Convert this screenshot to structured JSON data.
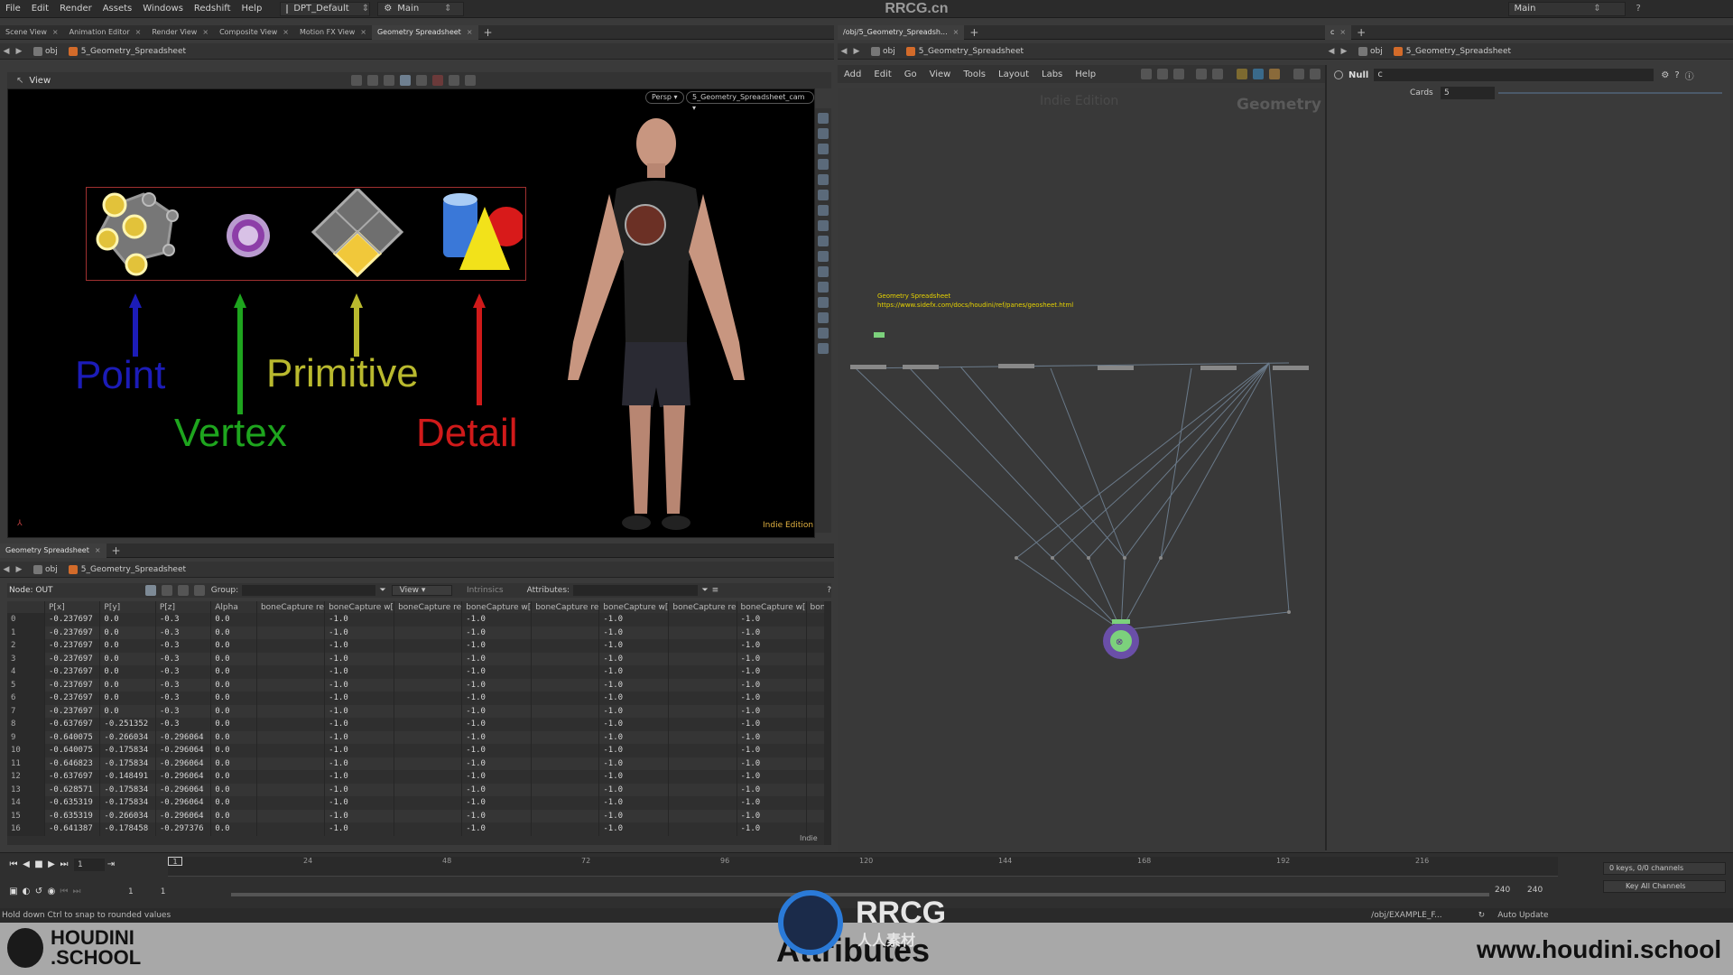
{
  "menubar": {
    "items": [
      "File",
      "Edit",
      "Render",
      "Assets",
      "Windows",
      "Redshift",
      "Help"
    ],
    "desktop": "DPT_Default",
    "context": "Main",
    "right_context": "Main"
  },
  "left_tabs": [
    "Scene View",
    "Animation Editor",
    "Render View",
    "Composite View",
    "Motion FX View",
    "Geometry Spreadsheet"
  ],
  "left_path": {
    "root": "obj",
    "node": "5_Geometry_Spreadsheet"
  },
  "viewport": {
    "label": "View",
    "persp": "Persp",
    "camera": "5_Geometry_Spreadsheet_cam",
    "edition": "Indie Edition",
    "labels": {
      "point": "Point",
      "vertex": "Vertex",
      "primitive": "Primitive",
      "detail": "Detail"
    },
    "colors": {
      "point": "#1c1cb8",
      "vertex": "#1ea51e",
      "primitive": "#b9b92e",
      "detail": "#d01a1a"
    }
  },
  "spreadsheet": {
    "tab": "Geometry Spreadsheet",
    "path_root": "obj",
    "path_node": "5_Geometry_Spreadsheet",
    "node_label": "Node: OUT",
    "group_label": "Group:",
    "view_label": "View",
    "intrinsics_label": "Intrinsics",
    "attributes_label": "Attributes:",
    "columns": [
      "",
      "P[x]",
      "P[y]",
      "P[z]",
      "Alpha",
      "boneCapture re",
      "boneCapture w[",
      "boneCapture re",
      "boneCapture w[",
      "boneCapture re",
      "boneCapture w[",
      "boneCapture re",
      "boneCapture w[",
      "bone"
    ],
    "rows": [
      [
        "0",
        "-0.237697",
        "0.0",
        "-0.3",
        "0.0",
        "",
        "-1.0",
        "",
        "-1.0",
        "",
        "-1.0",
        "",
        "-1.0",
        ""
      ],
      [
        "1",
        "-0.237697",
        "0.0",
        "-0.3",
        "0.0",
        "",
        "-1.0",
        "",
        "-1.0",
        "",
        "-1.0",
        "",
        "-1.0",
        ""
      ],
      [
        "2",
        "-0.237697",
        "0.0",
        "-0.3",
        "0.0",
        "",
        "-1.0",
        "",
        "-1.0",
        "",
        "-1.0",
        "",
        "-1.0",
        ""
      ],
      [
        "3",
        "-0.237697",
        "0.0",
        "-0.3",
        "0.0",
        "",
        "-1.0",
        "",
        "-1.0",
        "",
        "-1.0",
        "",
        "-1.0",
        ""
      ],
      [
        "4",
        "-0.237697",
        "0.0",
        "-0.3",
        "0.0",
        "",
        "-1.0",
        "",
        "-1.0",
        "",
        "-1.0",
        "",
        "-1.0",
        ""
      ],
      [
        "5",
        "-0.237697",
        "0.0",
        "-0.3",
        "0.0",
        "",
        "-1.0",
        "",
        "-1.0",
        "",
        "-1.0",
        "",
        "-1.0",
        ""
      ],
      [
        "6",
        "-0.237697",
        "0.0",
        "-0.3",
        "0.0",
        "",
        "-1.0",
        "",
        "-1.0",
        "",
        "-1.0",
        "",
        "-1.0",
        ""
      ],
      [
        "7",
        "-0.237697",
        "0.0",
        "-0.3",
        "0.0",
        "",
        "-1.0",
        "",
        "-1.0",
        "",
        "-1.0",
        "",
        "-1.0",
        ""
      ],
      [
        "8",
        "-0.637697",
        "-0.251352",
        "-0.3",
        "0.0",
        "",
        "-1.0",
        "",
        "-1.0",
        "",
        "-1.0",
        "",
        "-1.0",
        ""
      ],
      [
        "9",
        "-0.640075",
        "-0.266034",
        "-0.296064",
        "0.0",
        "",
        "-1.0",
        "",
        "-1.0",
        "",
        "-1.0",
        "",
        "-1.0",
        ""
      ],
      [
        "10",
        "-0.640075",
        "-0.175834",
        "-0.296064",
        "0.0",
        "",
        "-1.0",
        "",
        "-1.0",
        "",
        "-1.0",
        "",
        "-1.0",
        ""
      ],
      [
        "11",
        "-0.646823",
        "-0.175834",
        "-0.296064",
        "0.0",
        "",
        "-1.0",
        "",
        "-1.0",
        "",
        "-1.0",
        "",
        "-1.0",
        ""
      ],
      [
        "12",
        "-0.637697",
        "-0.148491",
        "-0.296064",
        "0.0",
        "",
        "-1.0",
        "",
        "-1.0",
        "",
        "-1.0",
        "",
        "-1.0",
        ""
      ],
      [
        "13",
        "-0.628571",
        "-0.175834",
        "-0.296064",
        "0.0",
        "",
        "-1.0",
        "",
        "-1.0",
        "",
        "-1.0",
        "",
        "-1.0",
        ""
      ],
      [
        "14",
        "-0.635319",
        "-0.175834",
        "-0.296064",
        "0.0",
        "",
        "-1.0",
        "",
        "-1.0",
        "",
        "-1.0",
        "",
        "-1.0",
        ""
      ],
      [
        "15",
        "-0.635319",
        "-0.266034",
        "-0.296064",
        "0.0",
        "",
        "-1.0",
        "",
        "-1.0",
        "",
        "-1.0",
        "",
        "-1.0",
        ""
      ],
      [
        "16",
        "-0.641387",
        "-0.178458",
        "-0.297376",
        "0.0",
        "",
        "-1.0",
        "",
        "-1.0",
        "",
        "-1.0",
        "",
        "-1.0",
        ""
      ]
    ],
    "indie": "Indie"
  },
  "network": {
    "tab": "/obj/5_Geometry_Spreadsh...",
    "path_root": "obj",
    "path_node": "5_Geometry_Spreadsheet",
    "menu": [
      "Add",
      "Edit",
      "Go",
      "View",
      "Tools",
      "Layout",
      "Labs",
      "Help"
    ],
    "watermark_edition": "Indie Edition",
    "context_label": "Geometry",
    "sticky_title": "Geometry Spreadsheet",
    "sticky_url": "https://www.sidefx.com/docs/houdini/ref/panes/geosheet.html"
  },
  "params": {
    "tab": "c",
    "path_root": "obj",
    "path_node": "5_Geometry_Spreadsheet",
    "node_type": "Null",
    "node_name": "c",
    "cards_label": "Cards",
    "cards_value": "5"
  },
  "timeline": {
    "ticks": [
      "24",
      "48",
      "72",
      "96",
      "120",
      "144",
      "168",
      "192",
      "216"
    ],
    "current_frame": "1",
    "start": "1",
    "start2": "1",
    "end": "240",
    "end2": "240",
    "keys_label": "0 keys, 0/0 channels",
    "key_all": "Key All Channels"
  },
  "status": {
    "hint": "Hold down Ctrl to snap to rounded values",
    "path": "/obj/EXAMPLE_F...",
    "auto_update": "Auto Update"
  },
  "footer": {
    "logo_line1": "HOUDINI",
    "logo_line2": ".SCHOOL",
    "caption": "Attributes",
    "url": "www.houdini.school",
    "watermark": "RRCG",
    "watermark_sub": "人人素材",
    "watermark_top": "RRCG.cn"
  }
}
